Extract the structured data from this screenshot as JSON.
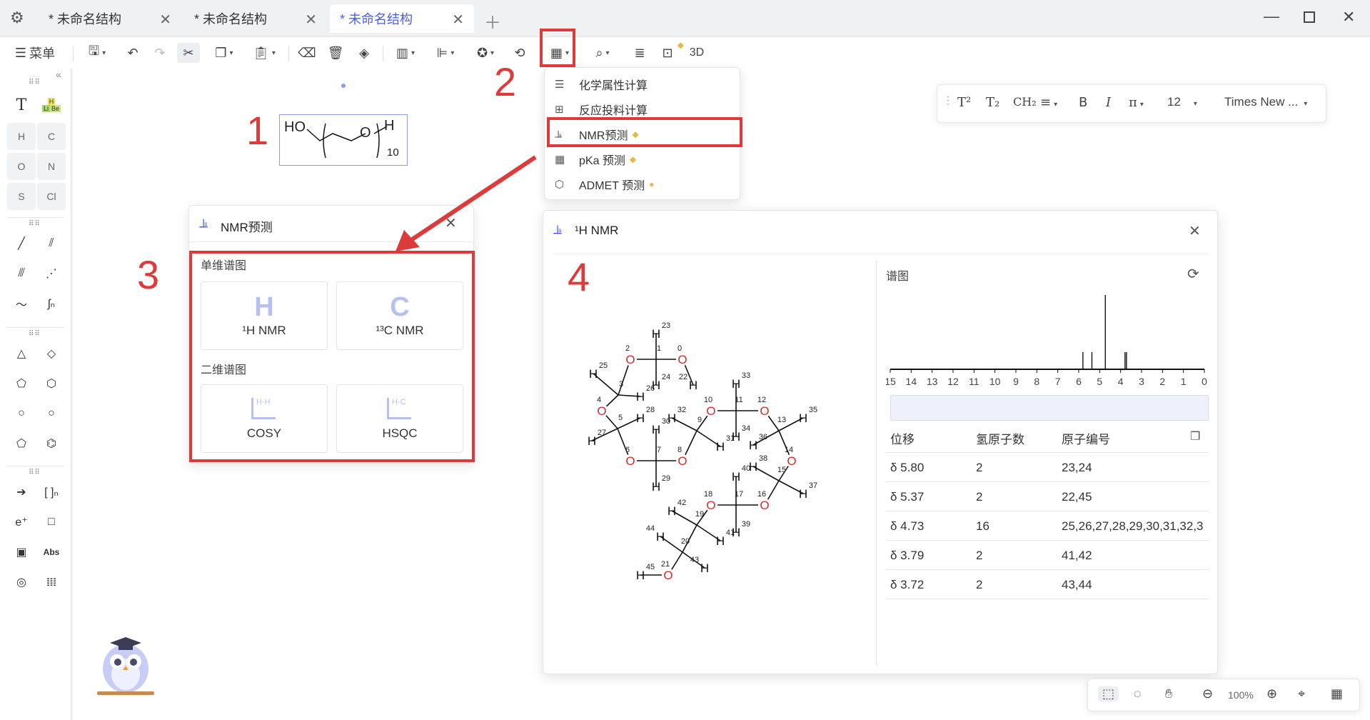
{
  "tabs": [
    {
      "label": "* 未命名结构"
    },
    {
      "label": "* 未命名结构"
    },
    {
      "label": "* 未命名结构",
      "active": true
    }
  ],
  "toolbar": {
    "menu_label": "菜单",
    "three_d": "3D",
    "tooltip": "剪切"
  },
  "palette": {
    "text": "T",
    "periodic": [
      "H",
      "Li",
      "Be"
    ],
    "elements": [
      "H",
      "C",
      "O",
      "N",
      "S",
      "Cl"
    ],
    "abs": "Abs"
  },
  "structure": {
    "ho": "HO",
    "h": "H",
    "n": "10"
  },
  "calc_menu": {
    "items": [
      "化学属性计算",
      "反应投料计算",
      "NMR预测",
      "pKa 预测",
      "ADMET 预测"
    ]
  },
  "format_bar": {
    "size": "12",
    "font": "Times New ..."
  },
  "predict_panel": {
    "title": "NMR预测",
    "section1": "单维谱图",
    "section2": "二维谱图",
    "h_nmr": "¹H NMR",
    "c_nmr": "¹³C NMR",
    "cosy": "COSY",
    "hsqc": "HSQC",
    "h_letter": "H",
    "c_letter": "C",
    "hh": "H-H",
    "hc": "H-C"
  },
  "nmr_window": {
    "title": "¹H NMR",
    "spectrum_label": "谱图",
    "axis_ticks": [
      "15",
      "14",
      "13",
      "12",
      "11",
      "10",
      "9",
      "8",
      "7",
      "6",
      "5",
      "4",
      "3",
      "2",
      "1",
      "0"
    ],
    "headers": [
      "位移",
      "氢原子数",
      "原子编号"
    ],
    "rows": [
      {
        "shift": "δ 5.80",
        "count": "2",
        "atoms": "23,24"
      },
      {
        "shift": "δ 5.37",
        "count": "2",
        "atoms": "22,45"
      },
      {
        "shift": "δ 4.73",
        "count": "16",
        "atoms": "25,26,27,28,29,30,31,32,3"
      },
      {
        "shift": "δ 3.79",
        "count": "2",
        "atoms": "41,42"
      },
      {
        "shift": "δ 3.72",
        "count": "2",
        "atoms": "43,44"
      }
    ]
  },
  "annotations": [
    "1",
    "2",
    "3",
    "4"
  ],
  "zoom": "100%",
  "colors": {
    "accent": "#4a5ee8",
    "annotation": "#dd3b3b",
    "oxygen": "#d42c2c",
    "gem": "#e8b94a"
  }
}
